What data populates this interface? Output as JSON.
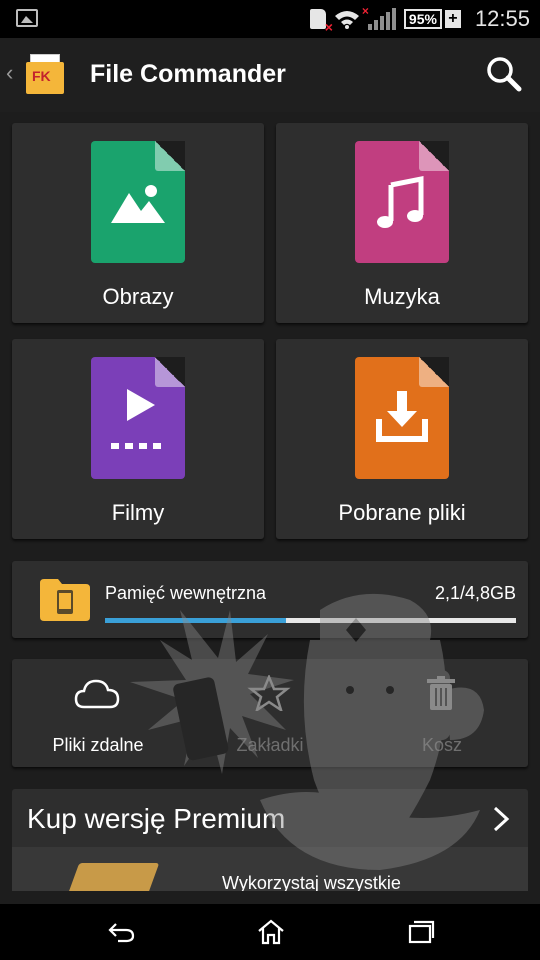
{
  "status_bar": {
    "battery": "95%",
    "time": "12:55",
    "icons": [
      "gallery-icon",
      "sdcard-error-icon",
      "wifi-icon",
      "signal-icon",
      "battery-icon",
      "charging-icon"
    ]
  },
  "action_bar": {
    "title": "File Commander",
    "logo_text": "FK",
    "icons": [
      "back-chevron-icon",
      "app-logo-icon",
      "search-icon"
    ]
  },
  "categories": [
    {
      "label": "Obrazy",
      "icon": "image-icon",
      "color": "#1aa36d"
    },
    {
      "label": "Muzyka",
      "icon": "music-note-icon",
      "color": "#c13e80"
    },
    {
      "label": "Filmy",
      "icon": "video-play-icon",
      "color": "#7b3fb8"
    },
    {
      "label": "Pobrane pliki",
      "icon": "download-icon",
      "color": "#e1701b"
    }
  ],
  "storage": {
    "name": "Pamięć wewnętrzna",
    "size": "2,1/4,8GB",
    "used_fraction": 0.44,
    "icon": "phone-folder-icon",
    "bar_color": "#3aa0d8"
  },
  "quick_actions": [
    {
      "label": "Pliki zdalne",
      "icon": "cloud-icon"
    },
    {
      "label": "Zakładki",
      "icon": "star-icon"
    },
    {
      "label": "Kosz",
      "icon": "trash-icon"
    }
  ],
  "premium": {
    "title": "Kup wersję Premium",
    "description": "Wykorzystaj wszystkie",
    "icon": "chevron-right-icon"
  },
  "nav_bar": {
    "icons": [
      "back-icon",
      "home-icon",
      "recents-icon"
    ]
  }
}
